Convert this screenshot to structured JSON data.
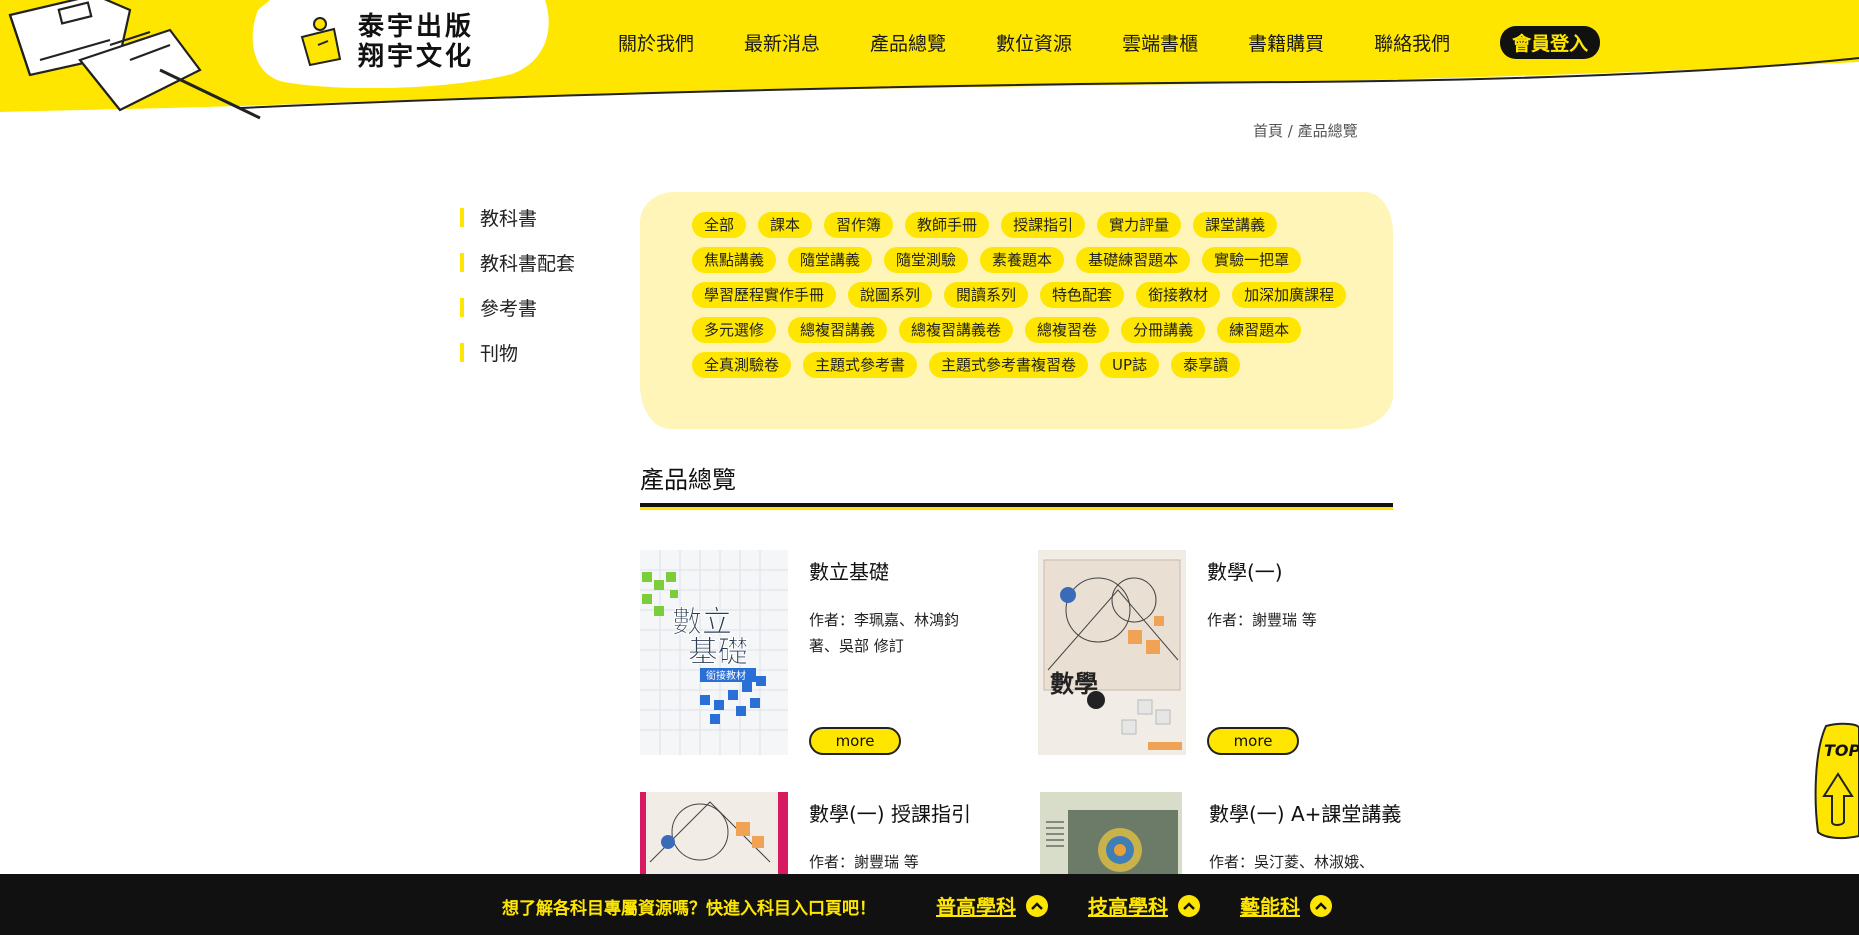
{
  "brand": {
    "line1": "泰宇出版",
    "line2": "翔宇文化"
  },
  "nav": {
    "items": [
      {
        "label": "關於我們"
      },
      {
        "label": "最新消息"
      },
      {
        "label": "產品總覽"
      },
      {
        "label": "數位資源"
      },
      {
        "label": "雲端書櫃"
      },
      {
        "label": "書籍購買"
      },
      {
        "label": "聯絡我們"
      }
    ],
    "login": "會員登入"
  },
  "breadcrumb": {
    "home": "首頁",
    "sep": " / ",
    "current": "產品總覽"
  },
  "sidebar": {
    "items": [
      {
        "label": "教科書"
      },
      {
        "label": "教科書配套"
      },
      {
        "label": "參考書"
      },
      {
        "label": "刊物"
      }
    ]
  },
  "tags": [
    "全部",
    "課本",
    "習作簿",
    "教師手冊",
    "授課指引",
    "實力評量",
    "課堂講義",
    "焦點講義",
    "隨堂講義",
    "隨堂測驗",
    "素養題本",
    "基礎練習題本",
    "實驗一把罩",
    "學習歷程實作手冊",
    "說圖系列",
    "閱讀系列",
    "特色配套",
    "銜接教材",
    "加深加廣課程",
    "多元選修",
    "總複習講義",
    "總複習講義卷",
    "總複習卷",
    "分冊講義",
    "練習題本",
    "全真測驗卷",
    "主題式參考書",
    "主題式參考書複習卷",
    "UP誌",
    "泰享讀"
  ],
  "section": {
    "title": "產品總覽"
  },
  "products": [
    {
      "title": "數立基礎",
      "author": "作者：李珮嘉、林鴻鈞著、吳部 修訂",
      "more": "more",
      "cover_text1": "數立",
      "cover_text2": "基礎",
      "cover_badge": "銜接教材"
    },
    {
      "title": "數學(一)",
      "author": "作者：謝豐瑞 等",
      "more": "more",
      "cover_text1": "數學"
    },
    {
      "title": "數學(一) 授課指引",
      "author": "作者：謝豐瑞 等"
    },
    {
      "title": "數學(一) A+課堂講義",
      "author": "作者：吳汀菱、林淑娥、"
    }
  ],
  "top_button": "TOP",
  "bottom_bar": {
    "prompt": "想了解各科目專屬資源嗎？快進入科目入口頁吧！",
    "links": [
      {
        "label": "普高學科"
      },
      {
        "label": "技高學科"
      },
      {
        "label": "藝能科"
      }
    ]
  },
  "colors": {
    "brand_yellow": "#ffe600",
    "pale_yellow": "#fff5b8",
    "dark": "#111111"
  }
}
